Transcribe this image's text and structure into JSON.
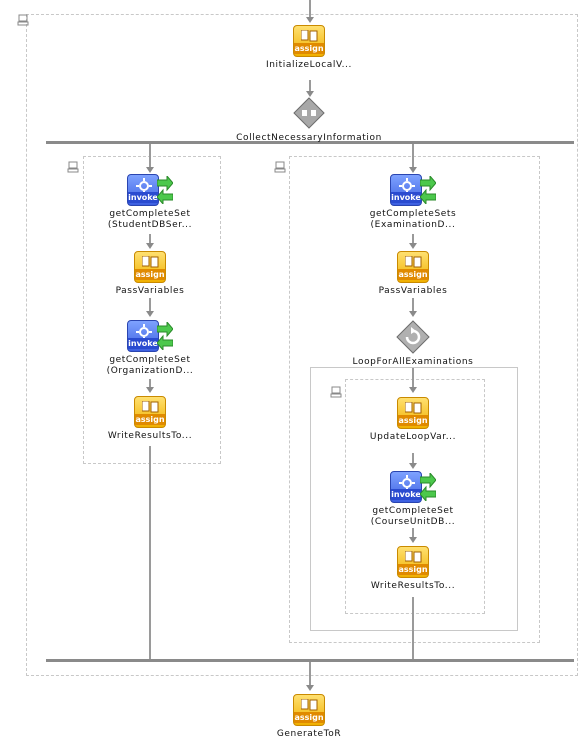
{
  "nodes": {
    "init": {
      "label": "InitializeLocalV...",
      "type_text": "assign"
    },
    "collect": {
      "label": "CollectNecessaryInformation"
    },
    "student": {
      "label1": "getCompleteSet",
      "label2": "(StudentDBSer...",
      "type_text": "invoke"
    },
    "pass_left": {
      "label": "PassVariables",
      "type_text": "assign"
    },
    "org": {
      "label1": "getCompleteSet",
      "label2": "(OrganizationD...",
      "type_text": "invoke"
    },
    "write_left": {
      "label": "WriteResultsTo...",
      "type_text": "assign"
    },
    "exam": {
      "label1": "getCompleteSets",
      "label2": "(ExaminationD...",
      "type_text": "invoke"
    },
    "pass_right": {
      "label": "PassVariables",
      "type_text": "assign"
    },
    "loop": {
      "label": "LoopForAllExaminations"
    },
    "update": {
      "label": "UpdateLoopVar...",
      "type_text": "assign"
    },
    "course": {
      "label1": "getCompleteSet",
      "label2": "(CourseUnitDB...",
      "type_text": "invoke"
    },
    "write_inner": {
      "label": "WriteResultsTo...",
      "type_text": "assign"
    },
    "generate": {
      "label": "GenerateToR",
      "type_text": "assign"
    }
  },
  "colors": {
    "assign": "#f0b000",
    "invoke": "#3c5fe0",
    "connector": "#8a8a8a",
    "scope_border": "#c8c8c8"
  }
}
